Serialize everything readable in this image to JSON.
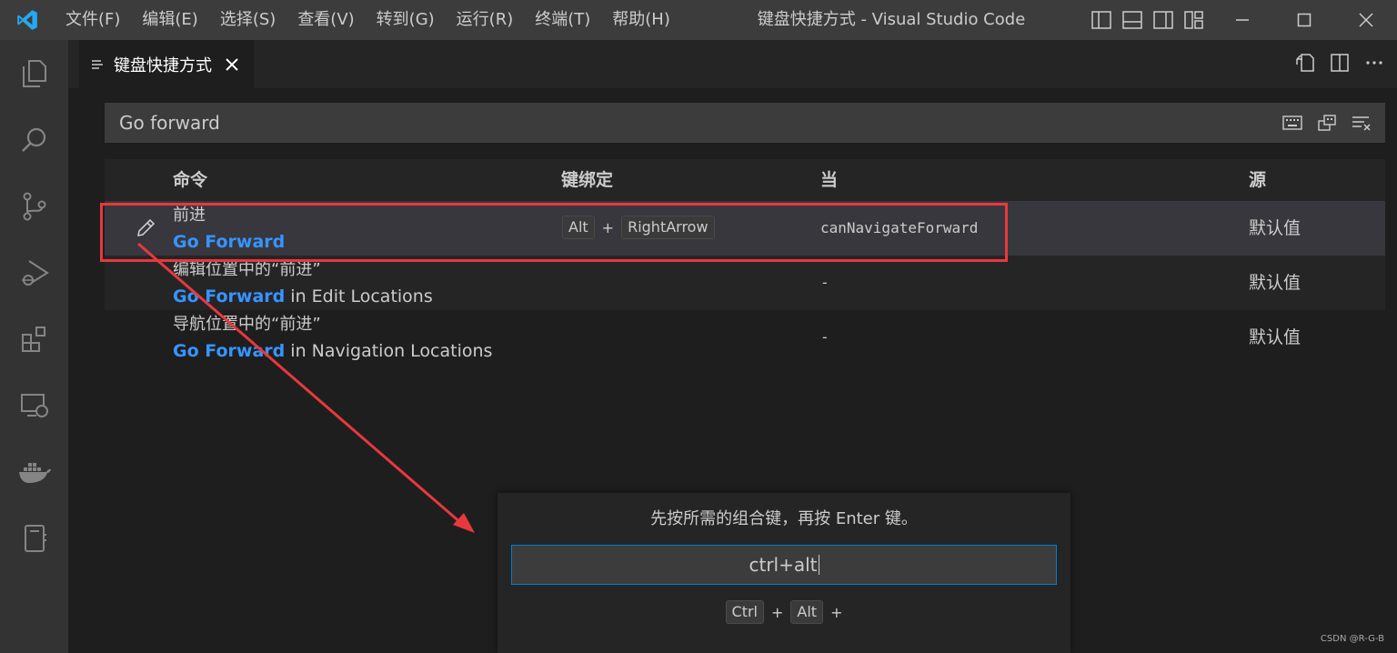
{
  "titlebar": {
    "menu": [
      "文件(F)",
      "编辑(E)",
      "选择(S)",
      "查看(V)",
      "转到(G)",
      "运行(R)",
      "终端(T)",
      "帮助(H)"
    ],
    "window_title": "键盘快捷方式 - Visual Studio Code",
    "accent": "#23a9f2"
  },
  "activity_bar": {
    "icons": [
      "files-icon",
      "search-icon",
      "source-control-icon",
      "run-debug-icon",
      "extensions-icon",
      "remote-explorer-icon",
      "docker-icon",
      "notebook-icon"
    ]
  },
  "tab": {
    "label": "键盘快捷方式"
  },
  "search": {
    "value": "Go forward"
  },
  "table": {
    "headers": {
      "command": "命令",
      "keybinding": "键绑定",
      "when": "当",
      "source": "源"
    },
    "rows": [
      {
        "command_zh": "前进",
        "command_hl": "Go Forward",
        "command_rest": "",
        "keys": [
          "Alt",
          "RightArrow"
        ],
        "when": "canNavigateForward",
        "source": "默认值"
      },
      {
        "command_zh": "编辑位置中的“前进”",
        "command_hl": "Go Forward",
        "command_rest": " in Edit Locations",
        "keys": [],
        "when": "-",
        "source": "默认值"
      },
      {
        "command_zh": "导航位置中的“前进”",
        "command_hl": "Go Forward",
        "command_rest": " in Navigation Locations",
        "keys": [],
        "when": "-",
        "source": "默认值"
      }
    ]
  },
  "define_widget": {
    "message": "先按所需的组合键，再按 Enter 键。",
    "input_value": "ctrl+alt",
    "keys": [
      "Ctrl",
      "Alt"
    ],
    "plus": "+"
  },
  "watermark": "CSDN @R-G-B",
  "annotation_color": "#e8383d"
}
